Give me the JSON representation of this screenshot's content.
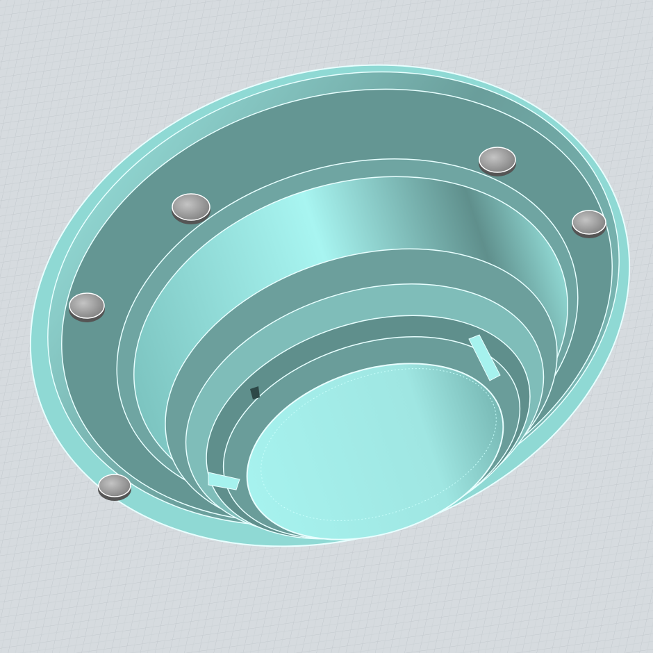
{
  "viewport": {
    "background_color": "#d6dbdf",
    "grid_color": "#c3c9ce",
    "part_color": "#a6f2ee",
    "part_shadow_color": "#5f8f8c",
    "edge_color": "#e8ffff",
    "screw_color": "#9a9a9a",
    "screw_count": 5
  }
}
